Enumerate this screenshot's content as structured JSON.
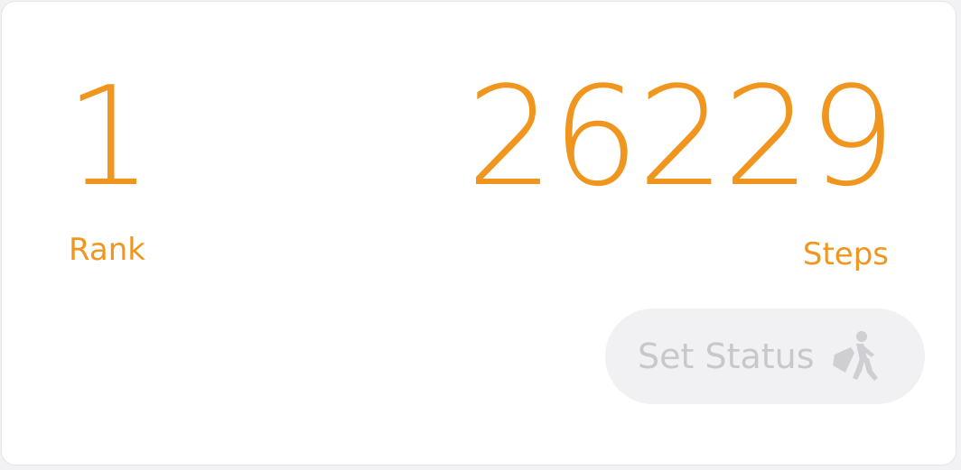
{
  "colors": {
    "accent": "#f0961e",
    "muted_text": "#c7c7cc",
    "icon": "#cfcfd3",
    "button_bg": "#f1f1f3",
    "card_bg": "#ffffff"
  },
  "stats": {
    "rank": {
      "value": "1",
      "label": "Rank"
    },
    "steps": {
      "value": "26229",
      "label": "Steps"
    }
  },
  "status_button": {
    "label": "Set Status",
    "icon": "walking-person-with-flag-icon"
  }
}
